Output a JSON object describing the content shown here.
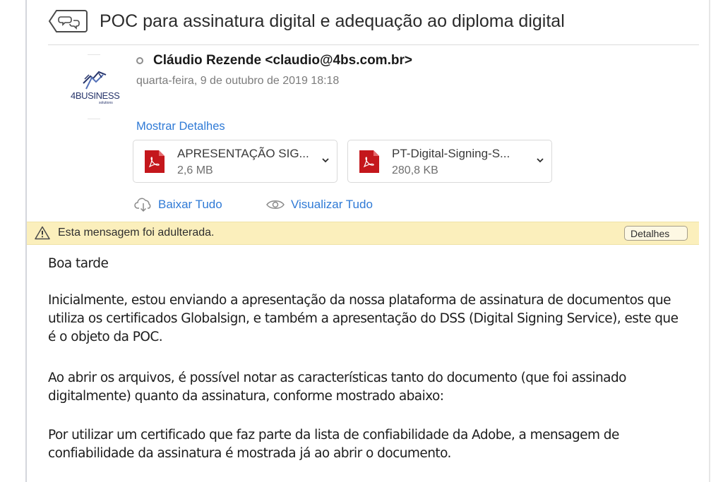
{
  "message": {
    "subject": "POC para assinatura digital e adequação ao diploma digital",
    "sender": "Cláudio Rezende <claudio@4bs.com.br>",
    "date": "quarta-feira, 9 de outubro de 2019 18:18",
    "show_details_label": "Mostrar Detalhes",
    "logo_text": "4BUSINESS",
    "logo_sub": "solutions"
  },
  "attachments": [
    {
      "name": "APRESENTAÇÃO SIG...",
      "size": "2,6 MB",
      "icon": "pdf-icon"
    },
    {
      "name": "PT-Digital-Signing-S...",
      "size": "280,8 KB",
      "icon": "pdf-icon"
    }
  ],
  "actions": {
    "download_all": "Baixar Tudo",
    "view_all": "Visualizar Tudo"
  },
  "warning": {
    "text": "Esta mensagem foi adulterada.",
    "button": "Detalhes"
  },
  "body": {
    "greeting": "Boa tarde",
    "paragraphs": [
      "Inicialmente, estou enviando a apresentação da nossa plataforma de assinatura de documentos que utiliza os certificados Globalsign, e também a apresentação do DSS (Digital Signing Service), este que é o objeto da POC.",
      "Ao abrir os arquivos, é possível notar as características tanto do documento (que foi assinado digitalmente) quanto da assinatura, conforme mostrado abaixo:",
      "Por utilizar um certificado que faz parte da lista de confiabilidade da Adobe, a mensagem de confiabilidade da assinatura é mostrada já ao abrir o documento."
    ]
  },
  "colors": {
    "link": "#2f7ad6",
    "warning_bg": "#fbefbc",
    "pdf_red": "#c4171c"
  }
}
